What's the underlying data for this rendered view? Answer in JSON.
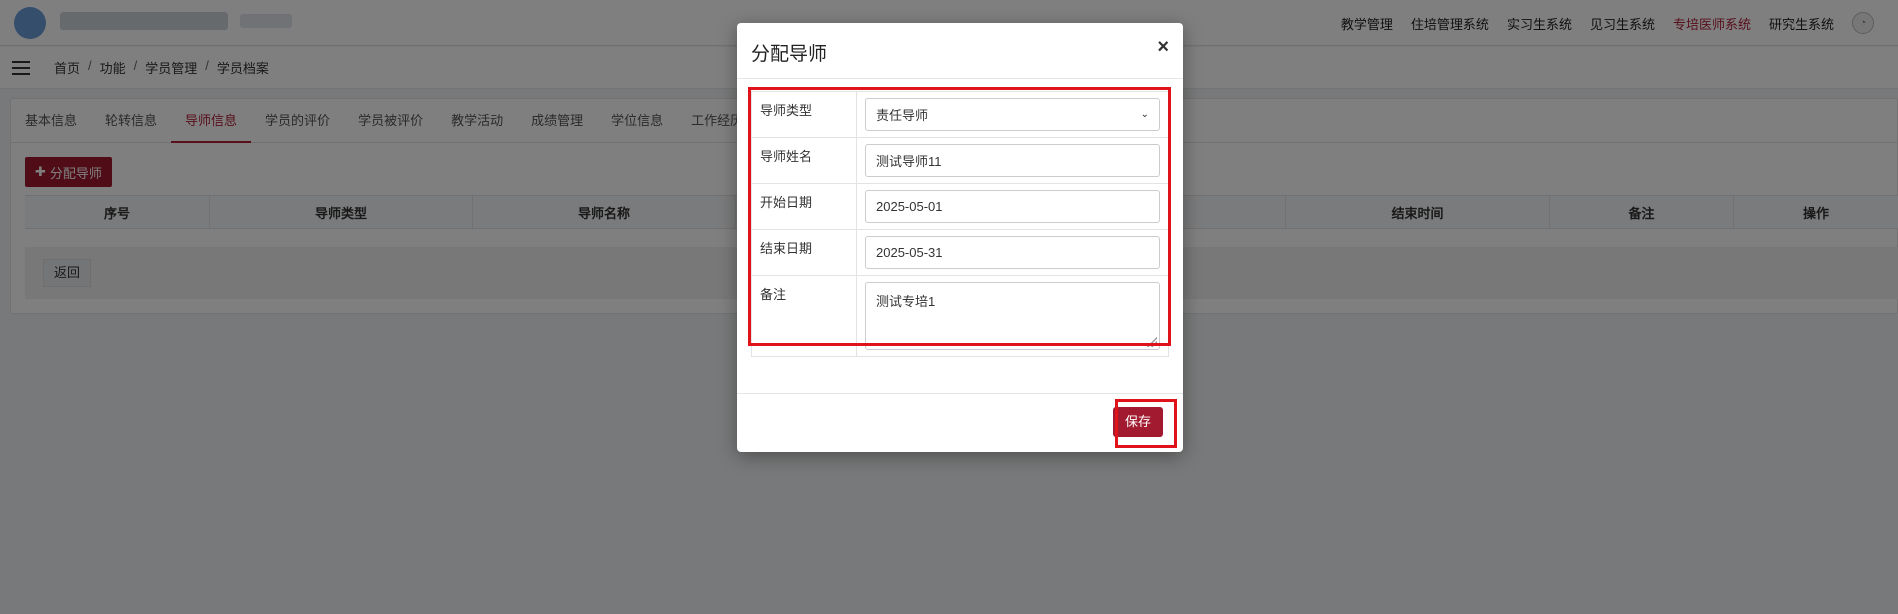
{
  "topnav": {
    "items": [
      "教学管理",
      "住培管理系统",
      "实习生系统",
      "见习生系统",
      "专培医师系统",
      "研究生系统"
    ],
    "active_index": 4
  },
  "breadcrumb": [
    "首页",
    "功能",
    "学员管理",
    "学员档案"
  ],
  "tabs": {
    "items": [
      "基本信息",
      "轮转信息",
      "导师信息",
      "学员的评价",
      "学员被评价",
      "教学活动",
      "成绩管理",
      "学位信息",
      "工作经历"
    ],
    "active_index": 2
  },
  "toolbar": {
    "assign_label": "分配导师"
  },
  "table": {
    "headers": [
      "序号",
      "导师类型",
      "导师名称",
      "结束时间",
      "备注",
      "操作"
    ]
  },
  "back_label": "返回",
  "modal": {
    "title": "分配导师",
    "close": "×",
    "fields": {
      "type_label": "导师类型",
      "type_value": "责任导师",
      "name_label": "导师姓名",
      "name_value": "测试导师11",
      "start_label": "开始日期",
      "start_value": "2025-05-01",
      "end_label": "结束日期",
      "end_value": "2025-05-31",
      "note_label": "备注",
      "note_value": "测试专培1"
    },
    "save_label": "保存"
  },
  "colors": {
    "accent": "#a11a2f",
    "highlight": "#e0121a"
  }
}
